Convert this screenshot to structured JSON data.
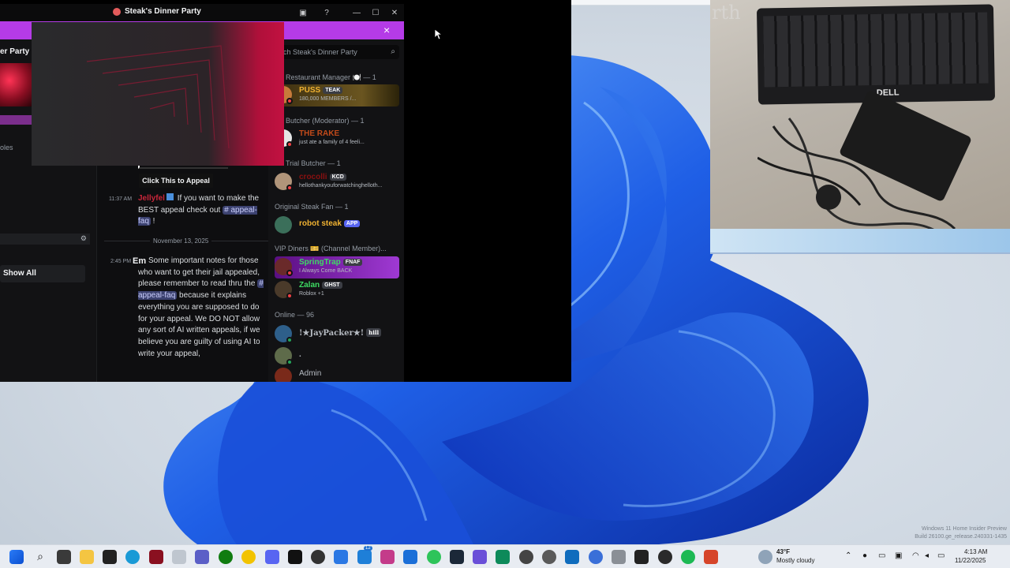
{
  "window": {
    "title": "Steak's Dinner Party",
    "close_banner": "×"
  },
  "server_panel": {
    "server_name": "er Party",
    "roles_label": "oles",
    "show_all": "Show All",
    "row_icon": "⚙"
  },
  "media": {
    "appeal_button": "Click This to Appeal"
  },
  "messages": [
    {
      "time": "11:37 AM",
      "author": "Jellyfel",
      "text_before": " If you want to make the BEST appeal check out ",
      "mention": "# appeal-faq",
      "text_after": " !"
    },
    {
      "time": "2:45 PM",
      "author": "Em",
      "text_before": "Some important notes for those who want to get their jail appealed, please remember to read thru the ",
      "mention": "# appeal-faq",
      "text_after": " because it explains everything you are supposed to do for your appeal. We DO NOT allow any sort of AI written appeals, if we believe you are guilty of using AI to write your appeal,"
    }
  ],
  "date_divider": "November 13, 2025",
  "search": {
    "placeholder": "rch Steak's Dinner Party"
  },
  "member_list": {
    "roles": [
      {
        "label": "Restaurant Manager 🍽️ — 1"
      },
      {
        "label": "Butcher (Moderator) — 1"
      },
      {
        "label": "Trial Butcher — 1"
      },
      {
        "label": "Original Steak Fan — 1"
      },
      {
        "label": "VIP Diners 🎫 (Channel Member)..."
      },
      {
        "label": "Online — 96"
      }
    ],
    "members": [
      {
        "name": "PUSS",
        "tag": "TEAK",
        "sub": "180,000 MEMBERS /...",
        "color": "#f0b232"
      },
      {
        "name": "THE RAKE",
        "tag": "",
        "sub": "just ate a family of 4 feeli...",
        "color": "#c24a1a"
      },
      {
        "name": "crocolli",
        "tag": "KCD",
        "sub": "hellothankyouforwatchinghelloth...",
        "color": "#8a1010"
      },
      {
        "name": "robot steak",
        "tag": "APP",
        "sub": "",
        "color": "#f0b232"
      },
      {
        "name": "SpringTrap",
        "tag": "FNAF",
        "sub": "I Always Come BACK",
        "color": "#3ddc63"
      },
      {
        "name": "Zalan",
        "tag": "GHST",
        "sub": "Roblox +1",
        "color": "#3ddc63"
      },
      {
        "name": "!★JayPacker★!",
        "tag": "hill",
        "sub": "",
        "color": "#b5bac1"
      },
      {
        "name": ".",
        "tag": "",
        "sub": "",
        "color": "#b5bac1"
      },
      {
        "name": "Admin",
        "tag": "",
        "sub": "",
        "color": "#b5bac1"
      }
    ]
  },
  "camera": {
    "keyboard_brand": "DELL",
    "desk_text": "rth"
  },
  "taskbar": {
    "weather_temp": "43°F",
    "weather_desc": "Mostly cloudy",
    "time": "4:13 AM",
    "date": "11/22/2025",
    "notif_badge": "12",
    "watermark_line1": "Windows 11 Home Insider Preview",
    "watermark_line2": "Build 26100.ge_release.240331-1435"
  }
}
